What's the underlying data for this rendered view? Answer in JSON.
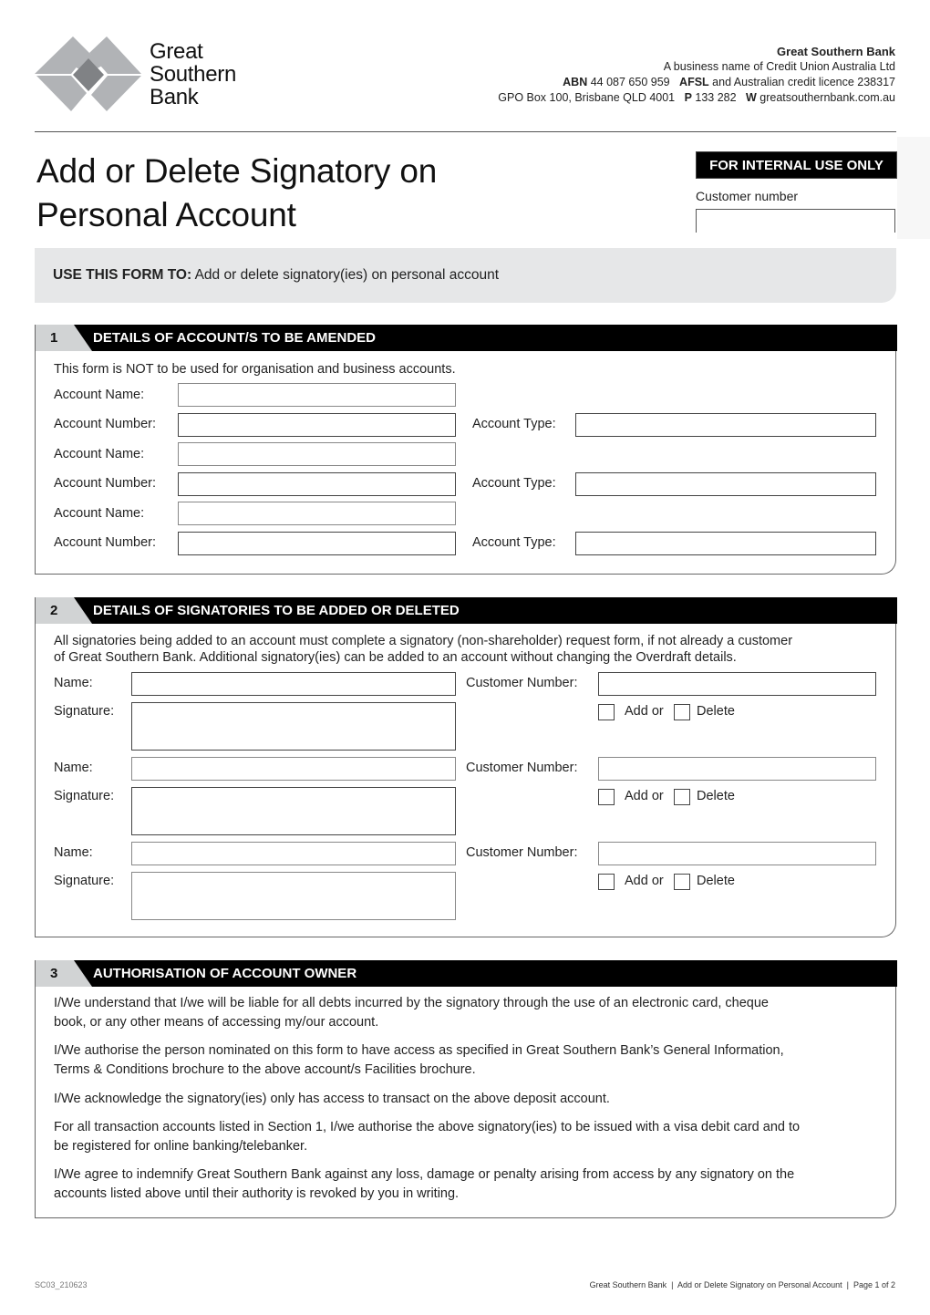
{
  "header": {
    "logo": {
      "icon": "diamond-logo-icon",
      "lines": [
        "Great",
        "Southern",
        "Bank"
      ]
    },
    "org": {
      "name": "Great Southern Bank",
      "line1": "A business name of Credit Union Australia Ltd",
      "abn_label": "ABN",
      "abn_value": " 44 087 650 959",
      "afsl_label": "AFSL",
      "afsl_value": " and Australian credit licence 238317",
      "address": "GPO Box 100, Brisbane QLD 4001",
      "phone_label": "P",
      "phone_value": " 133 282",
      "web_label": "W",
      "web_value": " greatsouthernbank.com.au"
    }
  },
  "title": {
    "line1": "Add or Delete Signatory on",
    "line2": "Personal Account"
  },
  "internal": {
    "badge": "FOR INTERNAL USE ONLY",
    "customer_number_label": "Customer number",
    "customer_number_value": ""
  },
  "use_form": {
    "label": "USE THIS FORM TO:",
    "text": " Add or delete signatory(ies) on personal account"
  },
  "section1": {
    "number": "1",
    "title": "DETAILS OF ACCOUNT/S TO BE AMENDED",
    "note": "This form is NOT to be used for organisation and business accounts.",
    "labels": {
      "name": "Account Name:",
      "number": "Account Number:",
      "type": "Account Type:"
    },
    "accounts": [
      {
        "name": "",
        "number": "",
        "type": ""
      },
      {
        "name": "",
        "number": "",
        "type": ""
      },
      {
        "name": "",
        "number": "",
        "type": ""
      }
    ]
  },
  "section2": {
    "number": "2",
    "title": "DETAILS OF SIGNATORIES TO BE ADDED OR DELETED",
    "note_line1": "All signatories being added to an account must complete a signatory (non-shareholder) request form, if not already a customer",
    "note_line2": "of Great Southern Bank. Additional signatory(ies) can be added to an account without changing the Overdraft details.",
    "labels": {
      "name": "Name:",
      "signature": "Signature:",
      "customer_number": "Customer Number:",
      "add": "Add or",
      "delete": "Delete"
    },
    "signatories": [
      {
        "name": "",
        "customer_number": "",
        "add": false,
        "delete": false
      },
      {
        "name": "",
        "customer_number": "",
        "add": false,
        "delete": false
      },
      {
        "name": "",
        "customer_number": "",
        "add": false,
        "delete": false
      }
    ]
  },
  "section3": {
    "number": "3",
    "title": "AUTHORISATION OF ACCOUNT OWNER",
    "paragraphs": [
      [
        "I/We understand that I/we will be liable for all debts incurred by the signatory through the use of an electronic card, cheque",
        "book, or any other means of accessing my/our account."
      ],
      [
        "I/We authorise the person nominated on this form to have access as specified in Great Southern Bank’s General Information,",
        "Terms & Conditions brochure to the above account/s Facilities brochure."
      ],
      [
        "I/We acknowledge the signatory(ies) only has access to transact on the above deposit account."
      ],
      [
        "For all transaction accounts listed in Section 1, I/we authorise the above signatory(ies) to be issued with a visa debit card and to",
        "be registered for online banking/telebanker."
      ],
      [
        "I/We agree to indemnify Great Southern Bank against any loss, damage or penalty arising from access by any signatory on the",
        "accounts listed above until their authority is revoked by you in writing."
      ]
    ]
  },
  "footer": {
    "code": "SC03_210623",
    "right": "Great Southern Bank  |  Add or Delete Signatory on Personal Account  |  Page 1 of 2"
  }
}
